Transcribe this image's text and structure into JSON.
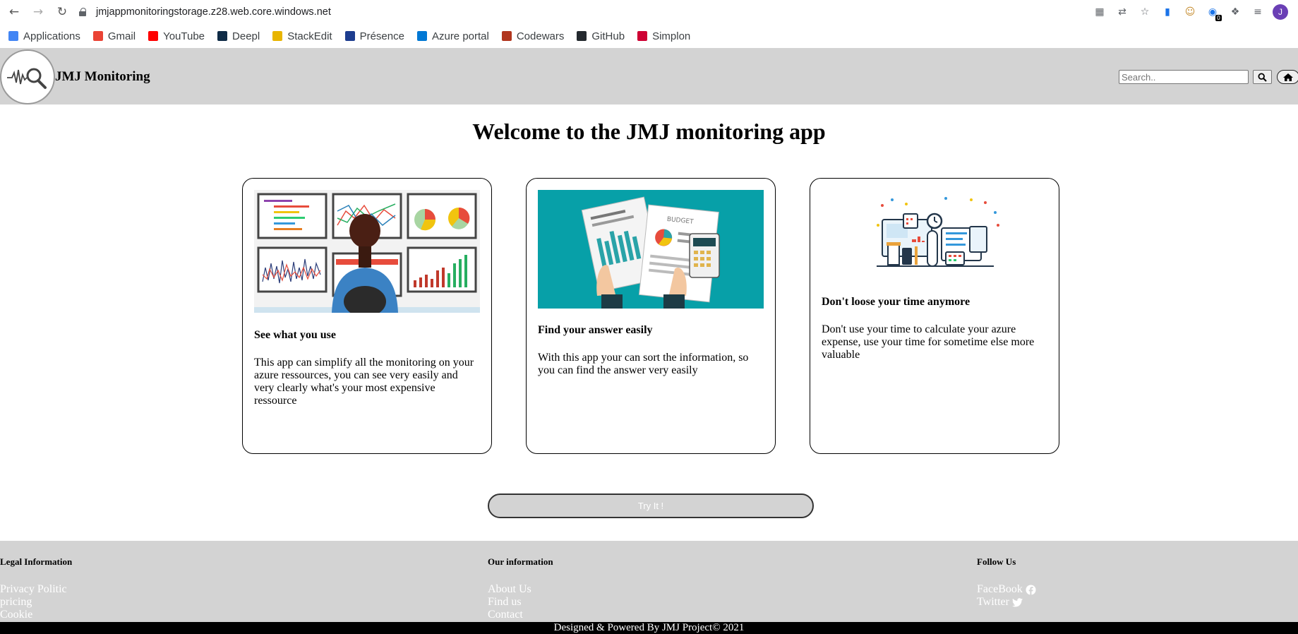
{
  "browser": {
    "url": "jmjappmonitoringstorage.z28.web.core.windows.net",
    "profile_initial": "J",
    "extension_badge": "0",
    "bookmarks": [
      {
        "label": "Applications",
        "icon": "apps-grid-icon",
        "color": "#4285f4"
      },
      {
        "label": "Gmail",
        "icon": "gmail-icon",
        "color": "#ea4335"
      },
      {
        "label": "YouTube",
        "icon": "youtube-icon",
        "color": "#ff0000"
      },
      {
        "label": "Deepl",
        "icon": "deepl-icon",
        "color": "#0f2b46"
      },
      {
        "label": "StackEdit",
        "icon": "stackedit-icon",
        "color": "#e8b500"
      },
      {
        "label": "Présence",
        "icon": "presence-icon",
        "color": "#1d3d8f"
      },
      {
        "label": "Azure portal",
        "icon": "azure-icon",
        "color": "#0078d4"
      },
      {
        "label": "Codewars",
        "icon": "codewars-icon",
        "color": "#b1361e"
      },
      {
        "label": "GitHub",
        "icon": "github-icon",
        "color": "#24292e"
      },
      {
        "label": "Simplon",
        "icon": "simplon-icon",
        "color": "#ce0033"
      }
    ]
  },
  "header": {
    "title": "JMJ Monitoring",
    "search_placeholder": "Search..",
    "logo_icon": "heartbeat-magnifier-icon"
  },
  "main": {
    "welcome": "Welcome to the JMJ monitoring app",
    "cards": [
      {
        "title": "See what you use",
        "text": "This app can simplify all the monitoring on your azure ressources, you can see very easily and very clearly what's your most expensive ressource"
      },
      {
        "title": "Find your answer easily",
        "text": "With this app your can sort the information, so you can find the answer very easily"
      },
      {
        "title": "Don't loose your time anymore",
        "text": "Don't use your time to calculate your azure expense, use your time for sometime else more valuable"
      }
    ],
    "try_label": "Try It !"
  },
  "footer": {
    "legal": {
      "heading": "Legal Information",
      "links": [
        "Privacy Politic",
        "pricing",
        "Cookie"
      ]
    },
    "info": {
      "heading": "Our information",
      "links": [
        "About Us",
        "Find us",
        "Contact"
      ]
    },
    "follow": {
      "heading": "Follow Us",
      "links": [
        "FaceBook",
        "Twitter"
      ]
    },
    "copyright": "Designed & Powered By JMJ Project© 2021"
  },
  "colors": {
    "header_bg": "#d3d3d3",
    "footer_bg": "#d3d3d3",
    "card_teal": "#07a0a8"
  }
}
